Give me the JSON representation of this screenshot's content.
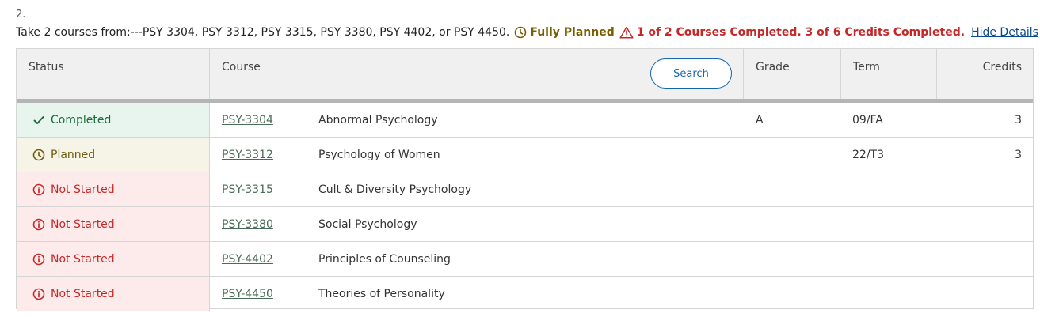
{
  "requirement": {
    "number": "2.",
    "text": "Take 2 courses from:---PSY 3304, PSY 3312, PSY 3315, PSY 3380, PSY 4402, or PSY 4450.",
    "fully_planned": "Fully Planned",
    "progress": "1 of 2 Courses Completed. 3 of 6 Credits Completed.",
    "hide_details": "Hide Details"
  },
  "table": {
    "headers": {
      "status": "Status",
      "course": "Course",
      "grade": "Grade",
      "term": "Term",
      "credits": "Credits"
    },
    "search_label": "Search",
    "rows": [
      {
        "status": "Completed",
        "code": "PSY-3304",
        "title": "Abnormal Psychology",
        "grade": "A",
        "term": "09/FA",
        "credits": "3"
      },
      {
        "status": "Planned",
        "code": "PSY-3312",
        "title": "Psychology of Women",
        "grade": "",
        "term": "22/T3",
        "credits": "3"
      },
      {
        "status": "Not Started",
        "code": "PSY-3315",
        "title": "Cult & Diversity Psychology",
        "grade": "",
        "term": "",
        "credits": ""
      },
      {
        "status": "Not Started",
        "code": "PSY-3380",
        "title": "Social Psychology",
        "grade": "",
        "term": "",
        "credits": ""
      },
      {
        "status": "Not Started",
        "code": "PSY-4402",
        "title": "Principles of Counseling",
        "grade": "",
        "term": "",
        "credits": ""
      },
      {
        "status": "Not Started",
        "code": "PSY-4450",
        "title": "Theories of Personality",
        "grade": "",
        "term": "",
        "credits": ""
      }
    ]
  },
  "icons": {
    "completed": "check-icon",
    "planned": "clock-icon",
    "not_started": "info-circle-icon",
    "warning": "warning-triangle-icon"
  },
  "colors": {
    "completed": "#1e6b3a",
    "planned": "#7a5d00",
    "not_started": "#c62828",
    "link": "#0a4a8a",
    "search": "#1565a8"
  }
}
